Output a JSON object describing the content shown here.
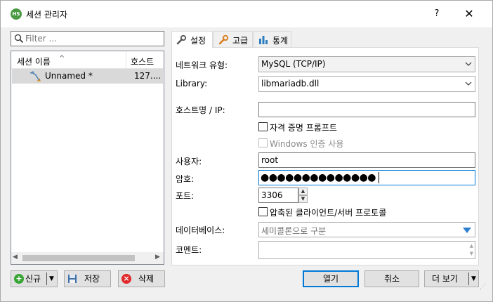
{
  "window": {
    "title": "세션 관리자",
    "help": "?",
    "close": "✕"
  },
  "filter": {
    "placeholder": "Filter ..."
  },
  "session_list": {
    "columns": [
      "세션 이름",
      "호스트"
    ],
    "sort_indicator": "^",
    "rows": [
      {
        "name": "Unnamed *",
        "host": "127...."
      }
    ]
  },
  "left_buttons": {
    "new": "신규",
    "save": "저장",
    "delete": "삭제"
  },
  "tabs": [
    {
      "label": "설정",
      "active": true
    },
    {
      "label": "고급",
      "active": false
    },
    {
      "label": "통계",
      "active": false
    }
  ],
  "settings": {
    "network_type_label": "네트워크 유형:",
    "network_type_value": "MySQL (TCP/IP)",
    "library_label": "Library:",
    "library_value": "libmariadb.dll",
    "hostname_label": "호스트명 / IP:",
    "hostname_value": "",
    "credential_prompt_label": "자격 증명 프롬프트",
    "windows_auth_label": "Windows 인증 사용",
    "user_label": "사용자:",
    "user_value": "root",
    "password_label": "암호:",
    "password_value": "●●●●●●●●●●●●●●",
    "port_label": "포트:",
    "port_value": "3306",
    "compressed_label": "압축된 클라이언트/서버 프로토콜",
    "databases_label": "데이터베이스:",
    "databases_placeholder": "세미콜론으로 구분",
    "comment_label": "코멘트:",
    "comment_value": ""
  },
  "bottom_buttons": {
    "open": "열기",
    "cancel": "취소",
    "more": "더 보기"
  },
  "colors": {
    "accent": "#0078d7",
    "selection": "#d9d9d9",
    "new_icon": "#3aa537",
    "delete_icon": "#e0292b",
    "app_icon": "#4a9a44"
  }
}
